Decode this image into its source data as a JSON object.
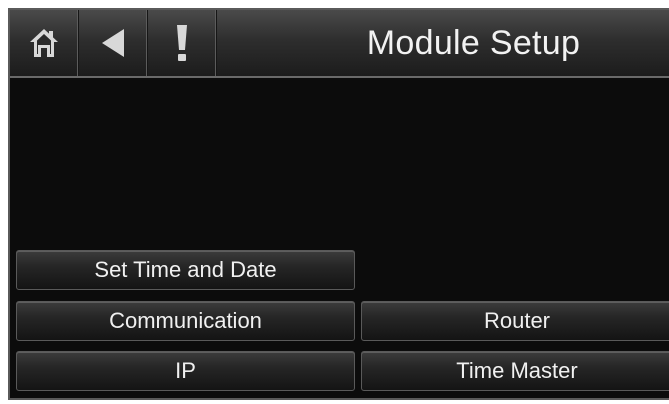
{
  "header": {
    "title": "Module Setup",
    "home_icon": "home-icon",
    "back_icon": "back-arrow-icon",
    "alert_icon": "exclamation-icon"
  },
  "buttons": {
    "set_time_date": "Set Time and Date",
    "communication": "Communication",
    "router": "Router",
    "ip": "IP",
    "time_master": "Time Master"
  },
  "colors": {
    "background": "#0c0c0c",
    "text": "#f0f0f0"
  }
}
